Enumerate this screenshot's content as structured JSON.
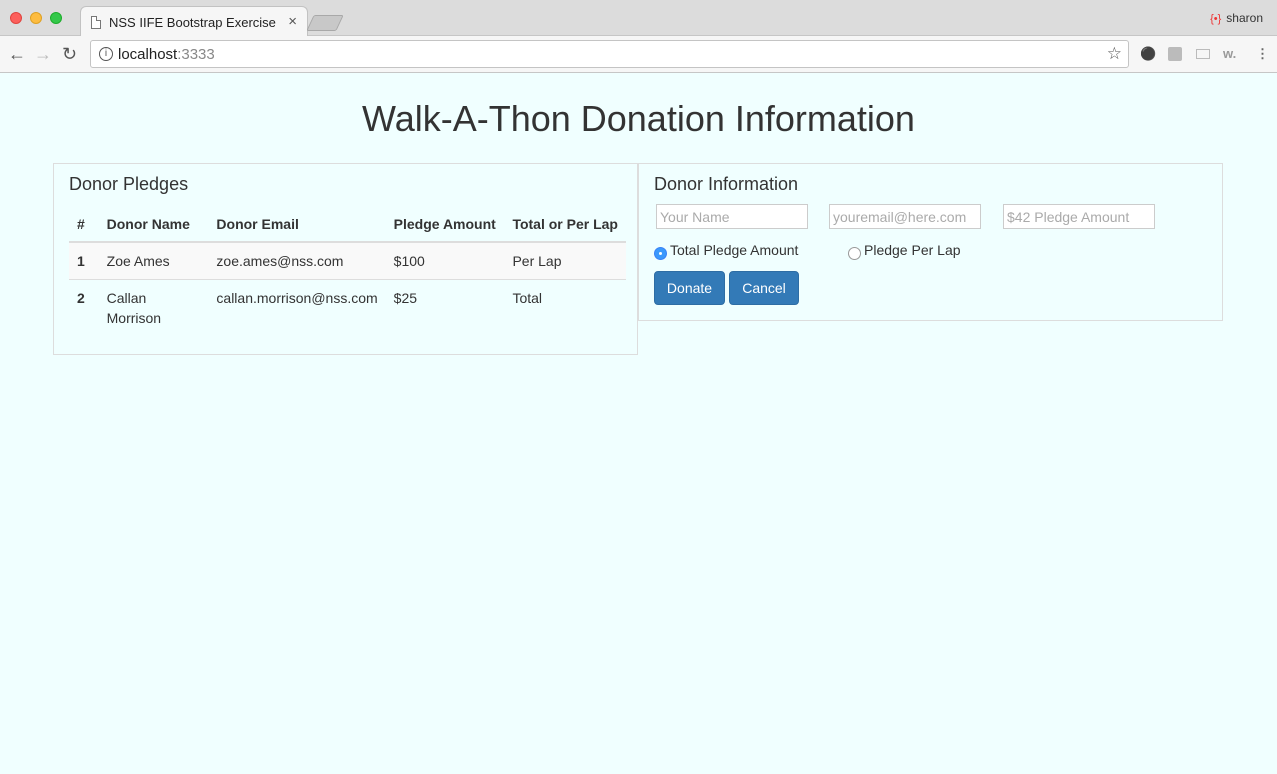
{
  "browser": {
    "tab_title": "NSS IIFE Bootstrap Exercise",
    "tab_close": "×",
    "url_host": "localhost",
    "url_port": ":3333",
    "profile_name": "sharon",
    "icons": [
      "back-arrow-icon",
      "forward-arrow-icon",
      "reload-icon",
      "info-icon",
      "star-icon",
      "evernote-icon",
      "extension-icon",
      "cast-icon",
      "wappalyzer-icon",
      "menu-icon"
    ]
  },
  "page": {
    "title": "Walk-A-Thon Donation Information"
  },
  "pledges": {
    "heading": "Donor Pledges",
    "columns": [
      "#",
      "Donor Name",
      "Donor Email",
      "Pledge Amount",
      "Total or Per Lap"
    ],
    "rows": [
      {
        "num": "1",
        "name": "Zoe Ames",
        "email": "zoe.ames@nss.com",
        "amount": "$100",
        "type": "Per Lap"
      },
      {
        "num": "2",
        "name": "Callan Morrison",
        "email": "callan.morrison@nss.com",
        "amount": "$25",
        "type": "Total"
      }
    ]
  },
  "form": {
    "heading": "Donor Information",
    "name_placeholder": "Your Name",
    "email_placeholder": "youremail@here.com",
    "amount_placeholder": "$42 Pledge Amount",
    "radio_total_label": "Total Pledge Amount",
    "radio_lap_label": "Pledge Per Lap",
    "selected_radio": "total",
    "donate_label": "Donate",
    "cancel_label": "Cancel"
  },
  "colors": {
    "background": "#f0ffff",
    "button": "#337ab7",
    "radio_selected": "#3b99fc"
  }
}
